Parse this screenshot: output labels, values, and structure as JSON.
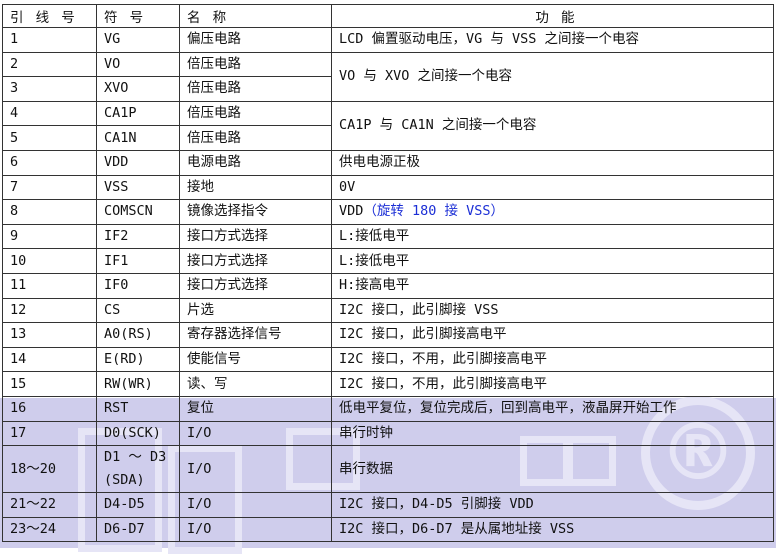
{
  "watermark": {
    "symbol": "®",
    "color": "#cfcdec"
  },
  "table": {
    "headers": {
      "pin": "引 线 号",
      "symbol": "符 号",
      "name": "名 称",
      "function": "功  能"
    },
    "rows": [
      {
        "pin": "1",
        "symbol": "VG",
        "name": "偏压电路",
        "function": "LCD 偏置驱动电压，VG 与 VSS 之间接一个电容"
      },
      {
        "pin": "2",
        "symbol": "VO",
        "name": "倍压电路",
        "function": "VO 与 XVO 之间接一个电容"
      },
      {
        "pin": "3",
        "symbol": "XVO",
        "name": "倍压电路"
      },
      {
        "pin": "4",
        "symbol": "CA1P",
        "name": "倍压电路",
        "function": "CA1P 与 CA1N 之间接一个电容"
      },
      {
        "pin": "5",
        "symbol": "CA1N",
        "name": "倍压电路"
      },
      {
        "pin": "6",
        "symbol": "VDD",
        "name": "电源电路",
        "function": "供电电源正极"
      },
      {
        "pin": "7",
        "symbol": "VSS",
        "name": "接地",
        "function": "0V"
      },
      {
        "pin": "8",
        "symbol": "COMSCN",
        "name": "镜像选择指令",
        "function": "VDD",
        "function_note": "（旋转 180 接 VSS）",
        "note_color": "#1c2fd6"
      },
      {
        "pin": "9",
        "symbol": "IF2",
        "name": "接口方式选择",
        "function": "L:接低电平"
      },
      {
        "pin": "10",
        "symbol": "IF1",
        "name": "接口方式选择",
        "function": "L:接低电平"
      },
      {
        "pin": "11",
        "symbol": "IF0",
        "name": "接口方式选择",
        "function": "H:接高电平"
      },
      {
        "pin": "12",
        "symbol": "CS",
        "name": "片选",
        "function": "I2C 接口，此引脚接 VSS"
      },
      {
        "pin": "13",
        "symbol": "A0(RS)",
        "name": "寄存器选择信号",
        "function": "I2C 接口，此引脚接高电平"
      },
      {
        "pin": "14",
        "symbol": "E(RD)",
        "name": "使能信号",
        "function": "I2C 接口，不用，此引脚接高电平"
      },
      {
        "pin": "15",
        "symbol": "RW(WR)",
        "name": "读、写",
        "function": "I2C 接口，不用，此引脚接高电平"
      },
      {
        "pin": "16",
        "symbol": "RST",
        "name": "复位",
        "function": "低电平复位，复位完成后，回到高电平，液晶屏开始工作"
      },
      {
        "pin": "17",
        "symbol": "D0(SCK)",
        "name": "I/O",
        "function": "串行时钟"
      },
      {
        "pin": "18～20",
        "symbol": "D1 ～ D3",
        "symbol_line2": "(SDA)",
        "name": "I/O",
        "function": "串行数据"
      },
      {
        "pin": "21～22",
        "symbol": "D4-D5",
        "name": "I/O",
        "function": "I2C 接口，D4-D5 引脚接 VDD"
      },
      {
        "pin": "23～24",
        "symbol": "D6-D7",
        "name": "I/O",
        "function": "I2C 接口，D6-D7 是从属地址接 VSS"
      }
    ]
  }
}
